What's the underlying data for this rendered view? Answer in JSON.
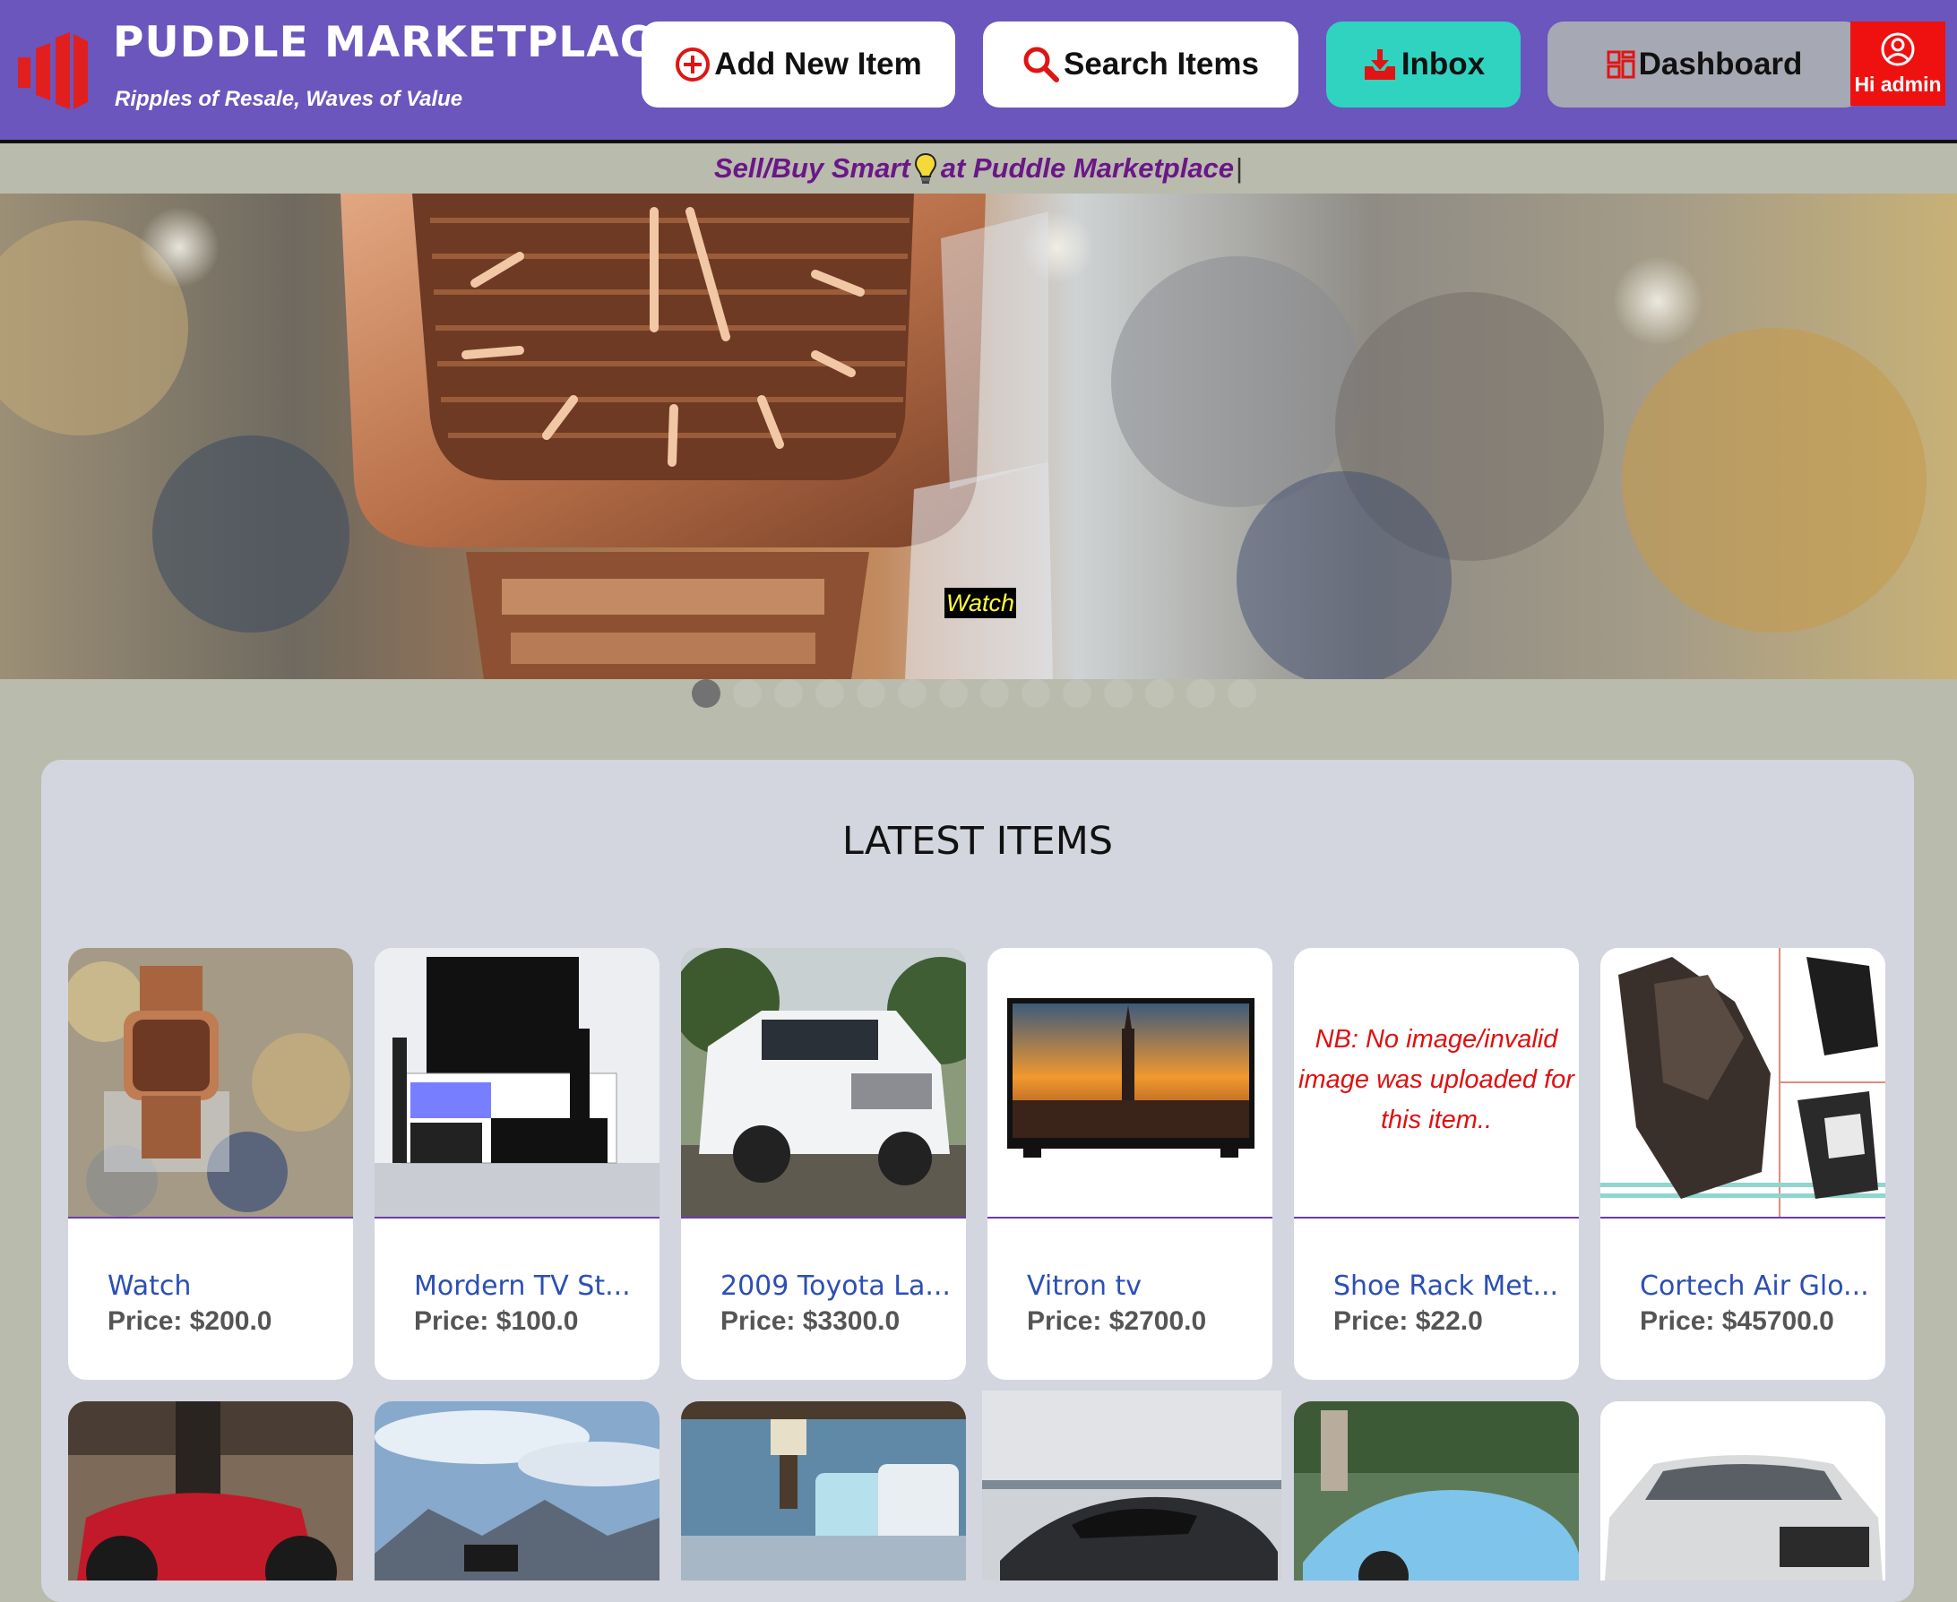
{
  "header": {
    "title": "PUDDLE MARKETPLACE",
    "tagline": "Ripples of Resale, Waves of Value",
    "nav": {
      "add_label": "Add New Item",
      "search_label": "Search Items",
      "inbox_label": "Inbox",
      "dashboard_label": "Dashboard"
    },
    "user_label": "Hi admin"
  },
  "ticker": {
    "text_before": "Sell/Buy Smart",
    "text_after": "at Puddle Marketplace",
    "caret": "|"
  },
  "hero": {
    "caption": "Watch",
    "slide_count": 14,
    "active_slide": 1
  },
  "latest": {
    "heading": "LATEST ITEMS",
    "items": [
      {
        "name": "Watch",
        "price": "Price: $200.0"
      },
      {
        "name": "Mordern TV St...",
        "price": "Price: $100.0"
      },
      {
        "name": "2009 Toyota La...",
        "price": "Price: $3300.0"
      },
      {
        "name": "Vitron tv",
        "price": "Price: $2700.0"
      },
      {
        "name": "Shoe Rack Met...",
        "price": "Price: $22.0",
        "no_image_note": "NB: No image/invalid image was uploaded for this item.."
      },
      {
        "name": "Cortech Air Glo...",
        "price": "Price: $45700.0"
      }
    ]
  },
  "colors": {
    "header_bg": "#6a56bd",
    "inbox_bg": "#2fd3c0",
    "dashboard_bg": "#a6a8b4",
    "user_bg": "#ef1010",
    "ticker_text": "#6a1788",
    "item_name": "#2b4fb4",
    "no_image_text": "#e01010",
    "page_bg": "#b9bbad",
    "panel_bg": "#d3d5df"
  },
  "icons": [
    "logo-icon",
    "add-circle-icon",
    "search-icon",
    "inbox-icon",
    "dashboard-icon",
    "user-icon",
    "lightbulb-icon"
  ]
}
